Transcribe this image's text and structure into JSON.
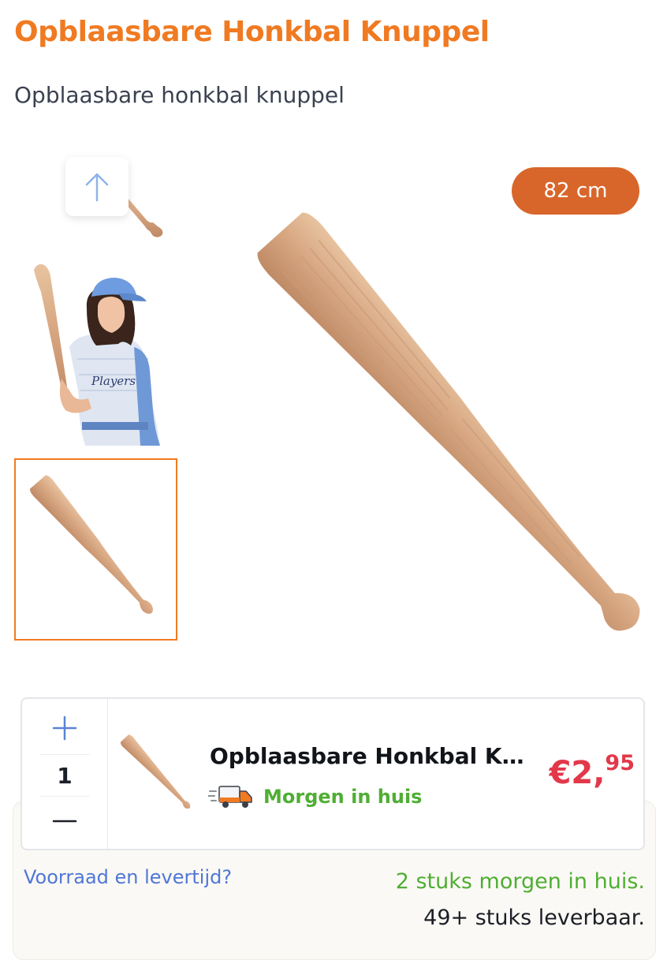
{
  "product": {
    "title": "Opblaasbare Honkbal Knuppel",
    "subtitle": "Opblaasbare honkbal knuppel"
  },
  "gallery": {
    "size_badge": "82 cm",
    "thumbnails": [
      {
        "name": "bat-thumbnail-partial",
        "selected": false
      },
      {
        "name": "model-with-bat-thumbnail",
        "selected": false
      },
      {
        "name": "bat-thumbnail",
        "selected": true
      }
    ],
    "scroll_up_icon": "arrow-up-icon"
  },
  "cart_item": {
    "name": "Opblaasbare Honkbal K...",
    "quantity": "1",
    "plus_icon": "plus-icon",
    "minus_icon": "minus-icon",
    "delivery_label": "Morgen in huis",
    "delivery_icon": "delivery-truck-icon",
    "price_main": "€2,",
    "price_cents": "95"
  },
  "stock": {
    "link": "Voorraad en levertijd?",
    "line1": "2 stuks morgen in huis.",
    "line2": "49+ stuks leverbaar."
  },
  "colors": {
    "accent": "#f07a22",
    "badge": "#d8662b",
    "price": "#e2384a",
    "delivery": "#4fae33",
    "link": "#4f77d6"
  }
}
